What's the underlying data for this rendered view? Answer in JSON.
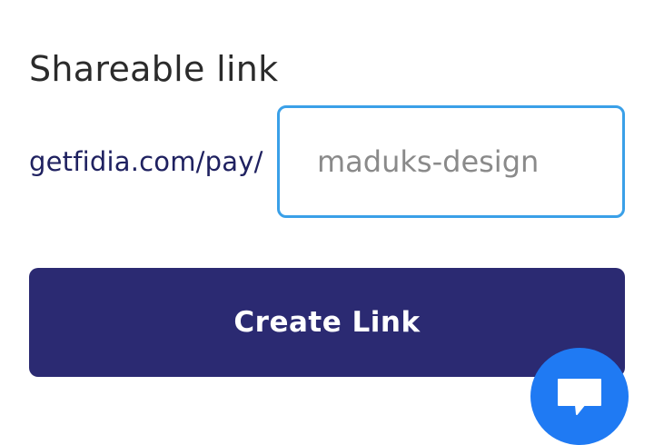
{
  "section": {
    "title": "Shareable link"
  },
  "link": {
    "prefix": "getfidia.com/pay/",
    "slug_placeholder": "maduks-design"
  },
  "actions": {
    "create_label": "Create Link"
  },
  "chat": {
    "icon": "chat-bubble-icon",
    "color": "#1f7af3"
  },
  "colors": {
    "primary": "#2b2a72",
    "input_focus_border": "#3aa0e8",
    "prefix_text": "#1f2160"
  }
}
